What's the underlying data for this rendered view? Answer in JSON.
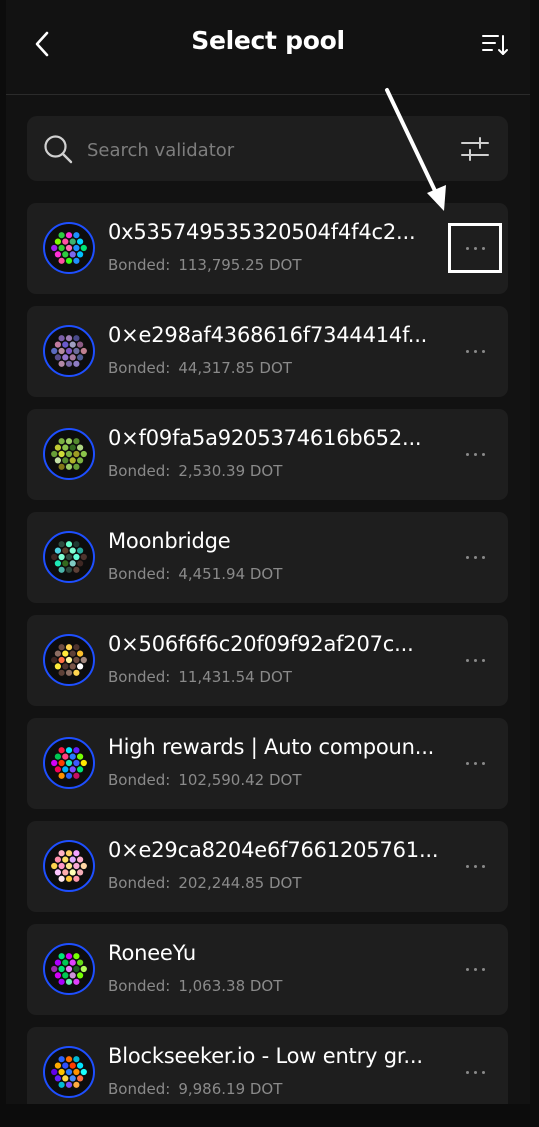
{
  "header": {
    "title": "Select pool",
    "back_icon": "chevron-left-icon",
    "sort_icon": "sort-icon"
  },
  "search": {
    "placeholder": "Search validator",
    "value": "",
    "search_icon": "search-icon",
    "filter_icon": "sliders-icon"
  },
  "bonded_label": "Bonded:",
  "colors": {
    "background": "#121212",
    "card": "#1e1e1e",
    "avatar_ring": "#1e4fff",
    "muted_text": "#8a8a8a",
    "annotation": "#ffffff"
  },
  "pools": [
    {
      "name": "0x535749535320504f4f4c2...",
      "bonded": "113,795.25 DOT",
      "highlighted": true,
      "avatar_colors": [
        "#2ecc40",
        "#ff2fd6",
        "#1e90ff",
        "#7cfc00",
        "#ff4fa3",
        "#3cb371",
        "#00d5ff",
        "#a020f0",
        "#32cd32",
        "#ff69b4",
        "#1e90ff",
        "#00e676",
        "#ff2fd6",
        "#2ecc40",
        "#7b68ee",
        "#00bfff",
        "#ff4fa3",
        "#39ff14",
        "#1e90ff"
      ]
    },
    {
      "name": "0×e298af4368616f7344414f...",
      "bonded": "44,317.85 DOT",
      "highlighted": false,
      "avatar_colors": [
        "#7b5ea7",
        "#9e7bb5",
        "#4a4a8a",
        "#c27ba0",
        "#6a5acd",
        "#a0a0c0",
        "#8b5a83",
        "#5c6bc0",
        "#b58ba0",
        "#7e57c2",
        "#6d6d9e",
        "#c08090",
        "#5a4e8c",
        "#9575cd",
        "#a67b9f",
        "#4f5b93",
        "#b388a8",
        "#7a6aa8",
        "#8e7cc3"
      ]
    },
    {
      "name": "0×f09fa5a9205374616b652...",
      "bonded": "2,530.39 DOT",
      "highlighted": false,
      "avatar_colors": [
        "#7cb342",
        "#9ccc65",
        "#558b2f",
        "#c0ca33",
        "#8bc34a",
        "#33691e",
        "#aed581",
        "#689f38",
        "#cddc39",
        "#7cb342",
        "#9e9d24",
        "#8bc34a",
        "#c5e1a5",
        "#558b2f",
        "#afb42b",
        "#7cb342",
        "#827717",
        "#9ccc65",
        "#689f38"
      ]
    },
    {
      "name": "Moonbridge",
      "bonded": "4,451.94 DOT",
      "highlighted": false,
      "avatar_colors": [
        "#2e4a3e",
        "#66ffcc",
        "#1f3b33",
        "#4dd0e1",
        "#5a3e2b",
        "#80ffd4",
        "#26a69a",
        "#3e2723",
        "#7fffd4",
        "#2e4a3e",
        "#64ffda",
        "#4e342e",
        "#1de9b6",
        "#33691e",
        "#80cbc4",
        "#3e2723",
        "#4db6ac",
        "#2e4a3e",
        "#5d4037"
      ]
    },
    {
      "name": "0×506f6f6c20f09f92af207c...",
      "bonded": "11,431.54 DOT",
      "highlighted": false,
      "avatar_colors": [
        "#6d4c41",
        "#ffd54f",
        "#4e342e",
        "#8d6e63",
        "#ffeb3b",
        "#5d4037",
        "#fbc02d",
        "#3e2723",
        "#ff7043",
        "#fff59d",
        "#6d4c41",
        "#a1887f",
        "#ffeb3b",
        "#4e342e",
        "#795548",
        "#ffffff",
        "#5d4037",
        "#8d6e63",
        "#ffd54f"
      ]
    },
    {
      "name": "High rewards | Auto compoun...",
      "bonded": "102,590.42 DOT",
      "highlighted": false,
      "avatar_colors": [
        "#ff1744",
        "#00e5ff",
        "#651fff",
        "#00c853",
        "#ff4081",
        "#2979ff",
        "#76ff03",
        "#d500f9",
        "#ff3d00",
        "#1de9b6",
        "#3d5afe",
        "#ffea00",
        "#f50057",
        "#00b0ff",
        "#7c4dff",
        "#00e676",
        "#ff9100",
        "#2962ff",
        "#c51162"
      ]
    },
    {
      "name": "0×e29ca8204e6f7661205761...",
      "bonded": "202,244.85 DOT",
      "highlighted": false,
      "avatar_colors": [
        "#ffb3c6",
        "#ffd166",
        "#f4a3ff",
        "#ff8fab",
        "#ffe066",
        "#e0aaff",
        "#ffafcc",
        "#fcd34d",
        "#ff99c8",
        "#fde68a",
        "#f9a8d4",
        "#ffd6a5",
        "#ffc6ff",
        "#ffadad",
        "#fdffb6",
        "#f4acb7",
        "#ffe5ec",
        "#ffca3a",
        "#ff99ac"
      ]
    },
    {
      "name": "RoneeYu",
      "bonded": "1,063.38 DOT",
      "highlighted": false,
      "avatar_colors": [
        "#00e676",
        "#d500f9",
        "#76ff03",
        "#aa00ff",
        "#00c853",
        "#e040fb",
        "#64dd17",
        "#9c27b0",
        "#00e676",
        "#ea80fc",
        "#1b5e20",
        "#b2ff59",
        "#d500f9",
        "#00c853",
        "#ce93d8",
        "#76ff03",
        "#aa00ff",
        "#69f0ae",
        "#e040fb"
      ]
    },
    {
      "name": "Blockseeker.io - Low entry gr...",
      "bonded": "9,986.19 DOT",
      "highlighted": false,
      "avatar_colors": [
        "#2962ff",
        "#ff6d00",
        "#00b8d4",
        "#ffab00",
        "#304ffe",
        "#ff3d00",
        "#00e5ff",
        "#6200ea",
        "#ffc400",
        "#2979ff",
        "#ff9100",
        "#18ffff",
        "#651fff",
        "#ffd740",
        "#448aff",
        "#ff6e40",
        "#00bcd4",
        "#7c4dff",
        "#ffab40"
      ]
    }
  ]
}
